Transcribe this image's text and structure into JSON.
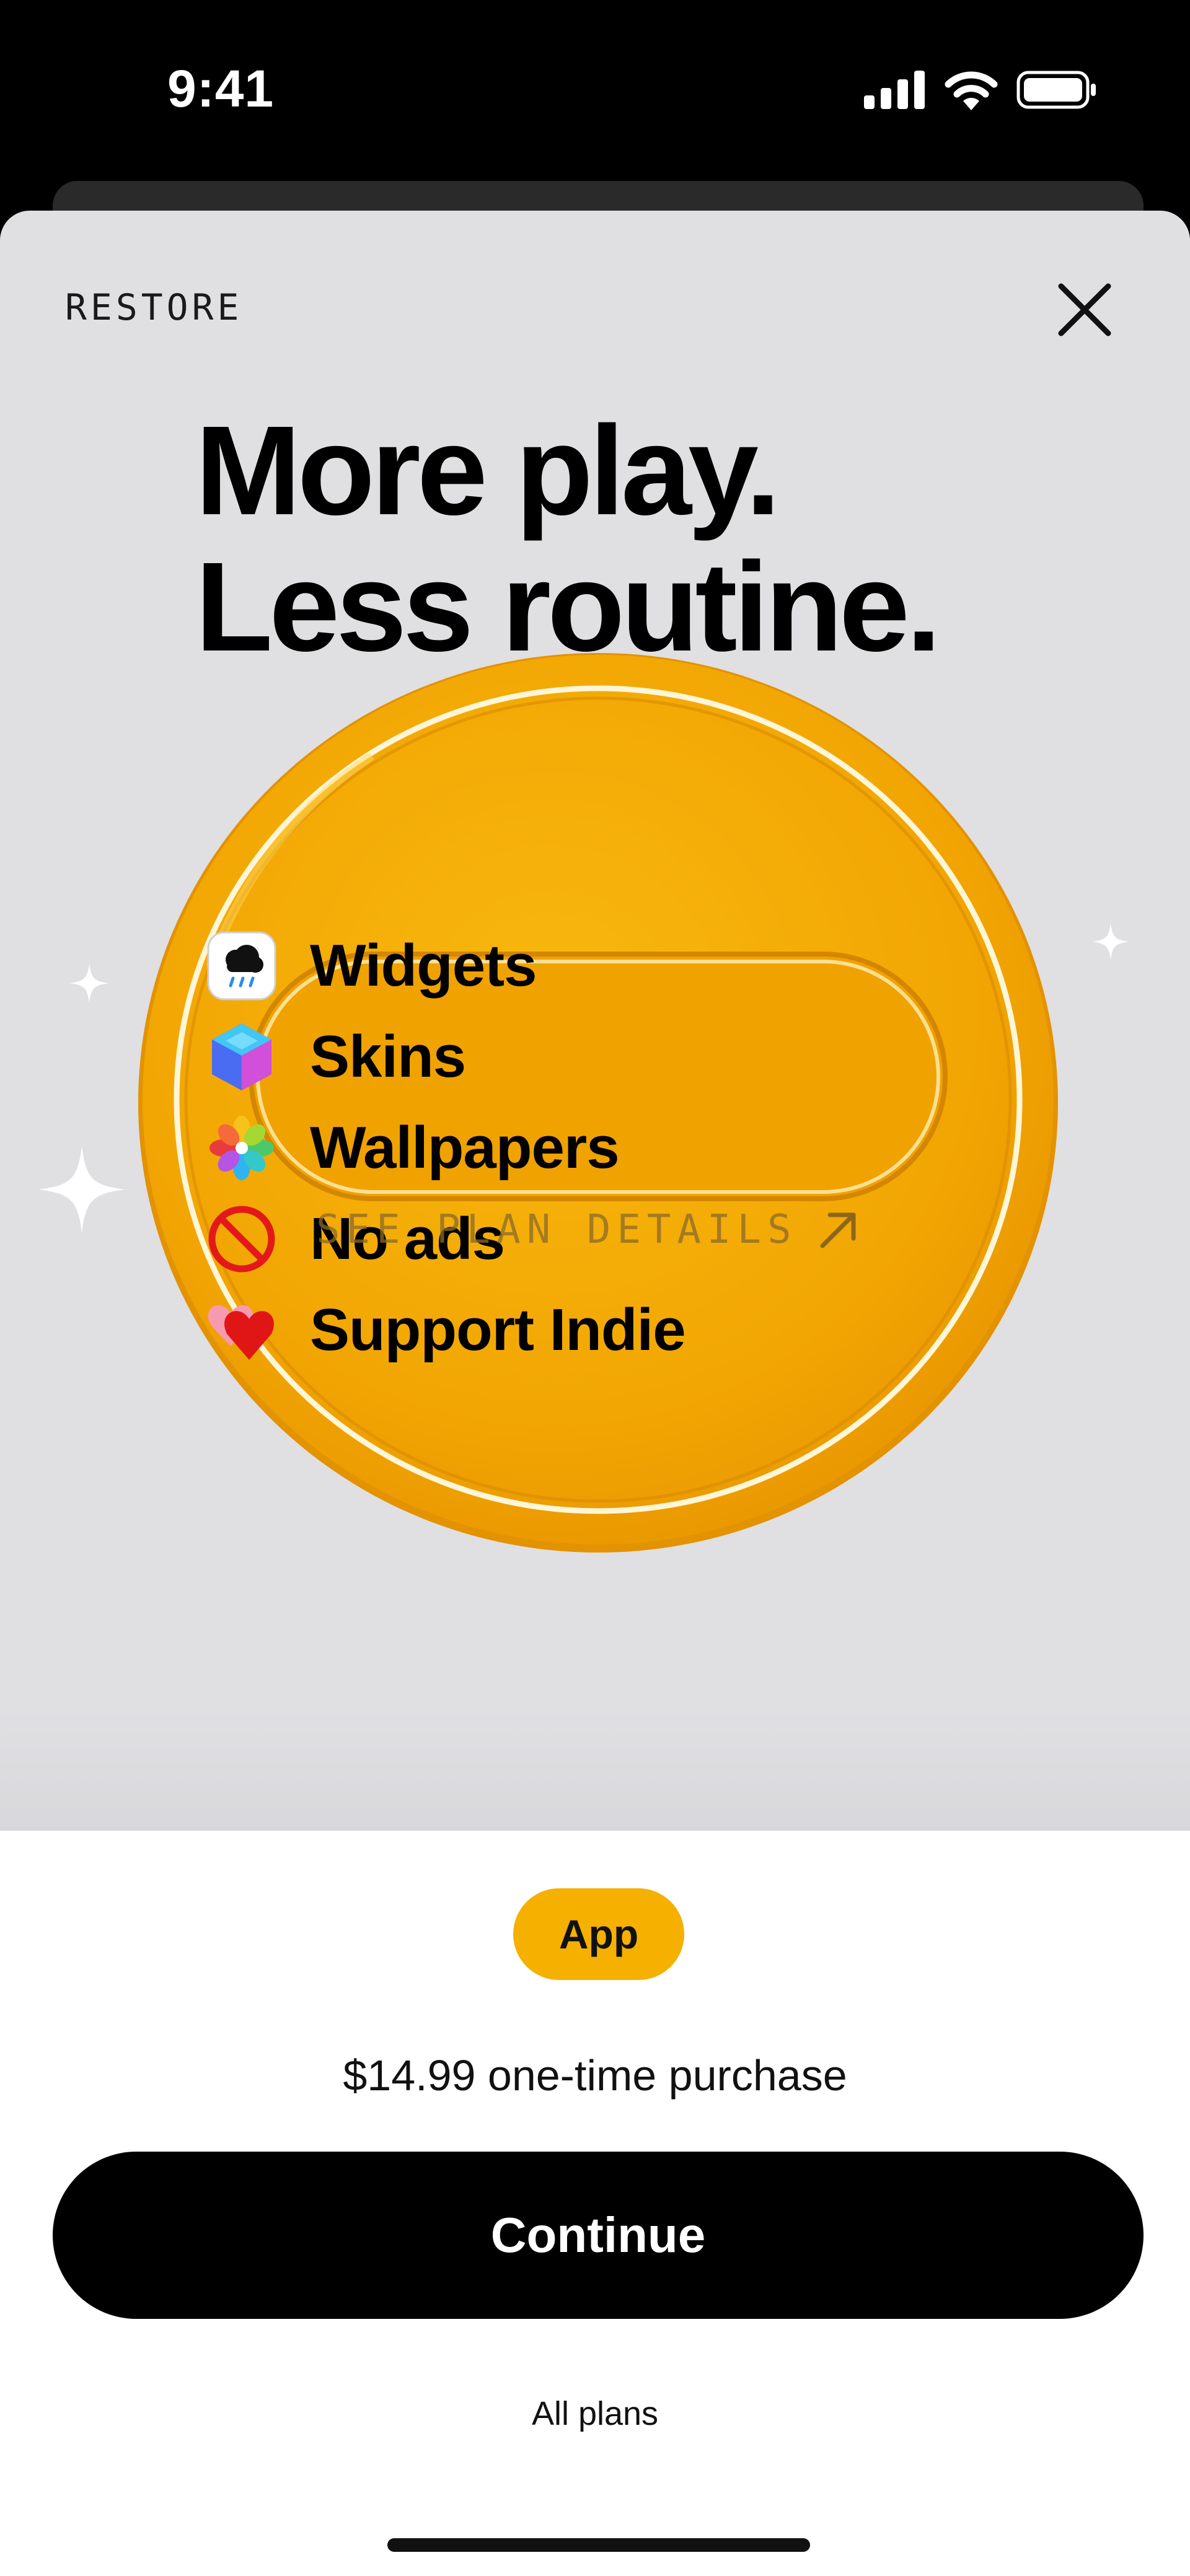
{
  "status_bar": {
    "time": "9:41"
  },
  "sheet": {
    "restore_label": "RESTORE",
    "headline": {
      "line1": "More play.",
      "line2": "Less routine."
    },
    "features": [
      {
        "label": "Widgets",
        "icon": "weather-cloud-icon"
      },
      {
        "label": "Skins",
        "icon": "cube-icon"
      },
      {
        "label": "Wallpapers",
        "icon": "flower-icon"
      },
      {
        "label": "No ads",
        "icon": "prohibited-icon"
      },
      {
        "label": "Support Indie",
        "icon": "heart-icon"
      }
    ],
    "plan_details_label": "SEE PLAN DETAILS"
  },
  "purchase": {
    "plan_badge": "App",
    "price_text": "$14.99 one-time purchase",
    "continue_label": "Continue",
    "all_plans_label": "All plans"
  },
  "colors": {
    "accent": "#f5b000",
    "sheet_background": "#e0dfe2",
    "button": "#000000"
  }
}
